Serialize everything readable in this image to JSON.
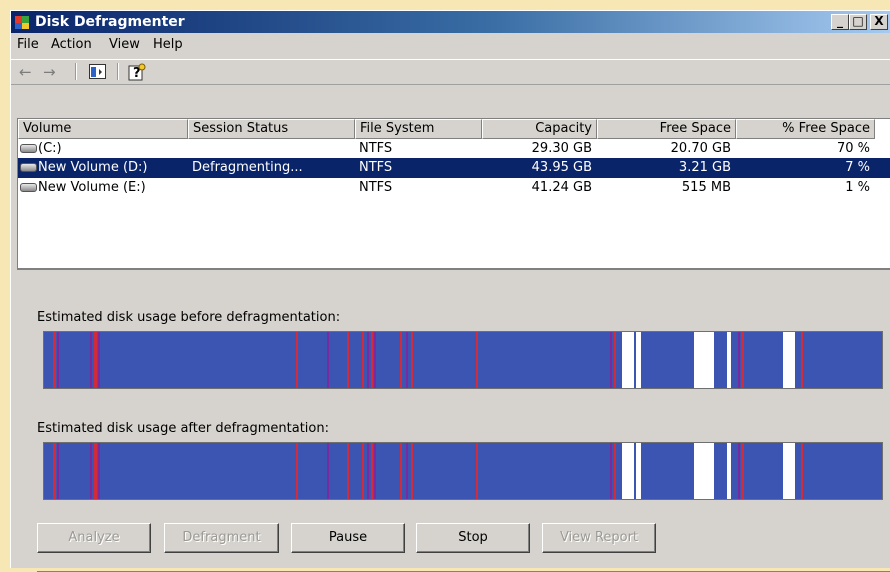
{
  "window": {
    "title": "Disk Defragmenter",
    "caption_buttons": {
      "minimize": "_",
      "maximize": "□",
      "close": "X"
    }
  },
  "menu": [
    "File",
    "Action",
    "View",
    "Help"
  ],
  "toolbar": {
    "icons": [
      "back-arrow-icon",
      "forward-arrow-icon",
      "show-hide-console-tree-icon",
      "help-icon"
    ]
  },
  "volumes": {
    "columns": [
      "Volume",
      "Session Status",
      "File System",
      "Capacity",
      "Free Space",
      "% Free Space"
    ],
    "rows": [
      {
        "volume": "(C:)",
        "status": "",
        "fs": "NTFS",
        "capacity": "29.30 GB",
        "free": "20.70 GB",
        "pct": "70 %",
        "selected": false
      },
      {
        "volume": "New Volume (D:)",
        "status": "Defragmenting...",
        "fs": "NTFS",
        "capacity": "43.95 GB",
        "free": "3.21 GB",
        "pct": "7 %",
        "selected": true
      },
      {
        "volume": "New Volume (E:)",
        "status": "",
        "fs": "NTFS",
        "capacity": "41.24 GB",
        "free": "515 MB",
        "pct": "1 %",
        "selected": false
      }
    ]
  },
  "analysis": {
    "before_label": "Estimated disk usage before defragmentation:",
    "after_label": "Estimated disk usage after defragmentation:",
    "colors": {
      "contiguous": "#3c55b3",
      "fragmented": "#d42b3a",
      "system": "#7b2a9e",
      "free": "#ffffff"
    }
  },
  "buttons": {
    "analyze": "Analyze",
    "defragment": "Defragment",
    "pause": "Pause",
    "stop": "Stop",
    "view_report": "View Report"
  }
}
